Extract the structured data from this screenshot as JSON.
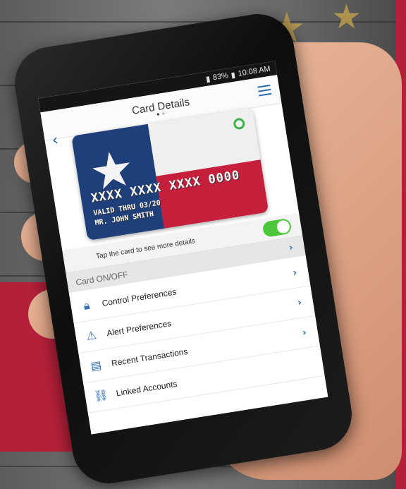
{
  "status_bar": {
    "battery": "83%",
    "time": "10:08 AM"
  },
  "nav": {
    "title": "Card Details"
  },
  "card": {
    "number": "XXXX XXXX XXXX 0000",
    "valid_thru": "VALID THRU 03/20",
    "cardholder": "MR. JOHN SMITH"
  },
  "pager": {
    "dots": [
      "active",
      "inactive"
    ]
  },
  "tap_hint": "Tap the card to see more details",
  "toggle": {
    "state": "on"
  },
  "section": {
    "label": "Card ON/OFF"
  },
  "list": [
    {
      "label": "Control Preferences",
      "icon": "lock-icon"
    },
    {
      "label": "Alert Preferences",
      "icon": "warning-icon"
    },
    {
      "label": "Recent Transactions",
      "icon": "receipt-icon"
    },
    {
      "label": "Linked Accounts",
      "icon": "link-icon"
    }
  ],
  "colors": {
    "accent": "#2b6cb0",
    "toggle_on": "#4cc63a",
    "brand_red": "#b4203a"
  }
}
